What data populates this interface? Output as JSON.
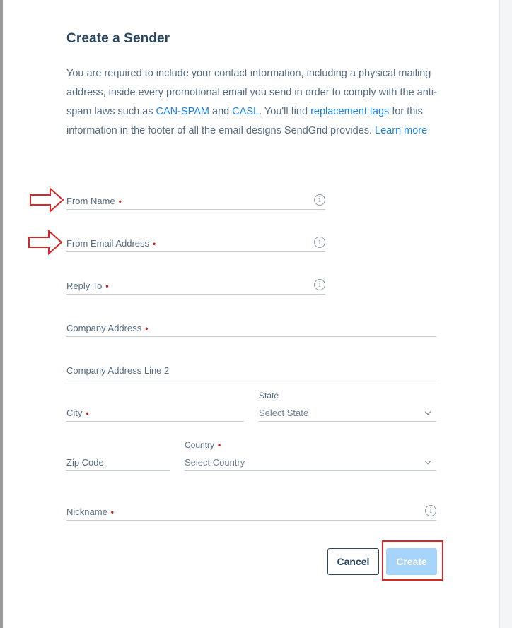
{
  "dialog": {
    "title": "Create a Sender",
    "intro": {
      "part1": "You are required to include your contact information, including a physical mailing address, inside every promotional email you send in order to comply with the anti-spam laws such as ",
      "link_canspam": "CAN-SPAM",
      "and": " and ",
      "link_casl": "CASL",
      "part2": ". You'll find ",
      "link_tags": "replacement tags",
      "part3": " for this information in the footer of all the email designs SendGrid provides. ",
      "link_learn": "Learn more"
    }
  },
  "form": {
    "from_name": "From Name",
    "from_email": "From Email Address",
    "reply_to": "Reply To",
    "company_address": "Company Address",
    "company_address_2": "Company Address Line 2",
    "city": "City",
    "state_label": "State",
    "state_value": "Select State",
    "zip": "Zip Code",
    "country_label": "Country",
    "country_value": "Select Country",
    "nickname": "Nickname",
    "required_mark": "•"
  },
  "buttons": {
    "cancel": "Cancel",
    "create": "Create"
  },
  "colors": {
    "link": "#1a82e2",
    "required": "#c5211b",
    "annotation": "#d62728",
    "create_disabled": "#a6d4fb"
  },
  "icons": [
    "info-icon",
    "chevron-down-icon",
    "arrow-right-icon"
  ]
}
